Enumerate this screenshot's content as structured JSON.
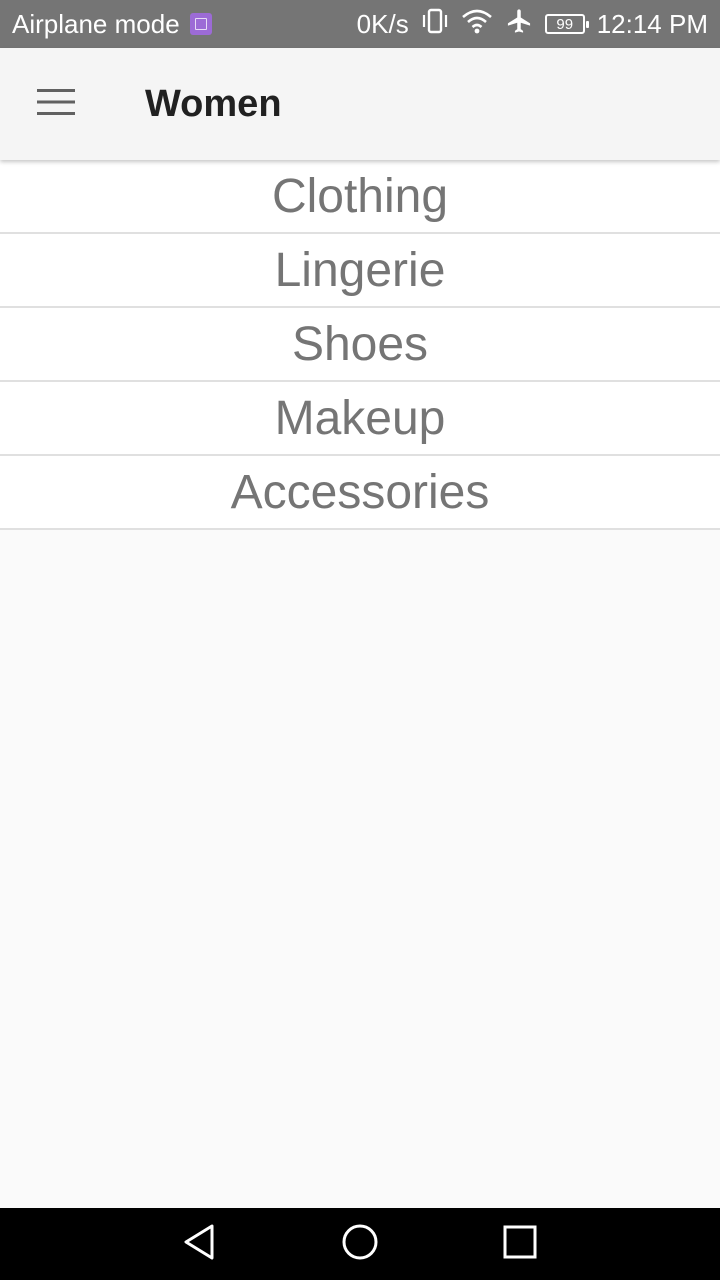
{
  "status_bar": {
    "left_text": "Airplane mode",
    "speed": "0K/s",
    "battery_level": "99",
    "time": "12:14 PM",
    "icons": [
      "image-notification-icon",
      "vibrate-icon",
      "wifi-icon",
      "airplane-icon",
      "battery-icon"
    ]
  },
  "app_bar": {
    "title": "Women",
    "menu_icon": "hamburger-menu-icon"
  },
  "categories": [
    {
      "label": "Clothing"
    },
    {
      "label": "Lingerie"
    },
    {
      "label": "Shoes"
    },
    {
      "label": "Makeup"
    },
    {
      "label": "Accessories"
    }
  ],
  "nav_bar": {
    "icons": [
      "back-icon",
      "home-icon",
      "recents-icon"
    ]
  },
  "colors": {
    "status_bar": "#757575",
    "app_bar": "#f5f5f5",
    "title_text": "#212121",
    "item_text": "#757575",
    "divider": "#e0e0e0",
    "background": "#fafafa",
    "nav_bar": "#000000"
  }
}
